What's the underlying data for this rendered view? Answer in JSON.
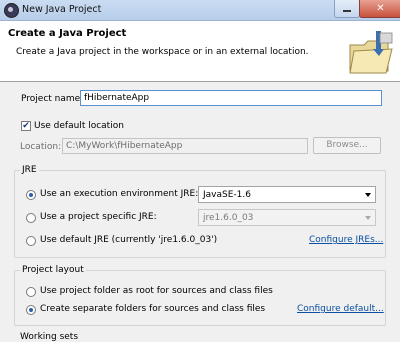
{
  "window": {
    "title": "New Java Project",
    "close_glyph": "✕"
  },
  "banner": {
    "heading": "Create a Java Project",
    "description": "Create a Java project in the workspace or in an external location."
  },
  "project_name": {
    "label": "Project name:",
    "value": "fHibernateApp"
  },
  "location": {
    "use_default_label": "Use default location",
    "use_default_checked": true,
    "check_glyph": "✔",
    "label": "Location:",
    "value": "C:\\MyWork\\fHibernateApp",
    "browse_label": "Browse..."
  },
  "jre": {
    "group_title": "JRE",
    "options": [
      {
        "label": "Use an execution environment JRE:",
        "selected": true,
        "combo_value": "JavaSE-1.6"
      },
      {
        "label": "Use a project specific JRE:",
        "selected": false,
        "combo_value": "jre1.6.0_03"
      },
      {
        "label": "Use default JRE (currently 'jre1.6.0_03')",
        "selected": false
      }
    ],
    "configure_link": "Configure JREs..."
  },
  "layout": {
    "group_title": "Project layout",
    "options": [
      {
        "label": "Use project folder as root for sources and class files",
        "selected": false
      },
      {
        "label": "Create separate folders for sources and class files",
        "selected": true
      }
    ],
    "configure_link": "Configure default..."
  },
  "working_sets": {
    "group_title": "Working sets"
  }
}
